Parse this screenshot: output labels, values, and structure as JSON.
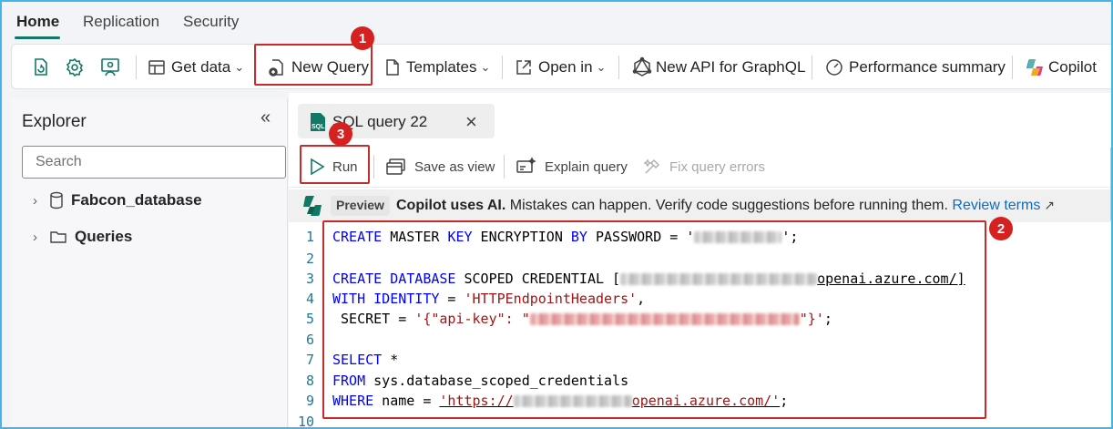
{
  "tabs": [
    {
      "label": "Home",
      "active": true
    },
    {
      "label": "Replication",
      "active": false
    },
    {
      "label": "Security",
      "active": false
    }
  ],
  "ribbon": {
    "refresh_icon": "refresh-icon",
    "settings_icon": "gear-icon",
    "share_icon": "person-share-icon",
    "get_data": "Get data",
    "new_query": "New Query",
    "templates": "Templates",
    "open_in": "Open in",
    "new_api": "New API for GraphQL",
    "performance": "Performance summary",
    "copilot": "Copilot"
  },
  "explorer": {
    "title": "Explorer",
    "search_placeholder": "Search",
    "items": [
      {
        "label": "Fabcon_database",
        "icon": "database-icon"
      },
      {
        "label": "Queries",
        "icon": "folder-icon"
      }
    ]
  },
  "query_tab": {
    "label": "SQL query 22",
    "icon_text": "SQL"
  },
  "query_toolbar": {
    "run": "Run",
    "save_as_view": "Save as view",
    "explain_query": "Explain query",
    "fix_errors": "Fix query errors"
  },
  "preview": {
    "badge": "Preview",
    "bold_text": "Copilot uses AI.",
    "text": "Mistakes can happen. Verify code suggestions before running them.",
    "link": "Review terms"
  },
  "code": {
    "line_numbers": [
      "1",
      "2",
      "3",
      "4",
      "5",
      "6",
      "7",
      "8",
      "9",
      "10"
    ],
    "l1": {
      "kw1": "CREATE",
      "t1": " MASTER ",
      "kw2": "KEY",
      "t2": " ENCRYPTION ",
      "kw3": "BY",
      "t3": " PASSWORD = '",
      "t4": "';"
    },
    "l3": {
      "kw1": "CREATE",
      "t1": " ",
      "kw2": "DATABASE",
      "t2": " SCOPED CREDENTIAL [",
      "t3": "openai.azure.com/]"
    },
    "l4": {
      "kw1": "WITH",
      "t1": " ",
      "kw2": "IDENTITY",
      "t2": " = ",
      "s1": "'HTTPEndpointHeaders'",
      "t3": ","
    },
    "l5": {
      "t1": " SECRET = ",
      "s1": "'{\"api-key\": \"",
      "s2": "\"}'",
      "t2": ";"
    },
    "l7": {
      "kw1": "SELECT",
      "t1": " *"
    },
    "l8": {
      "kw1": "FROM",
      "t1": " sys.database_scoped_credentials"
    },
    "l9": {
      "kw1": "WHERE",
      "t1": " name = ",
      "s1": "'https://",
      "s2": "openai.azure.com/'",
      "t2": ";"
    }
  },
  "callouts": [
    "1",
    "2",
    "3"
  ],
  "colors": {
    "accent": "#117865",
    "callout": "#d62121",
    "keyword": "#0000ff",
    "string": "#a31515"
  }
}
